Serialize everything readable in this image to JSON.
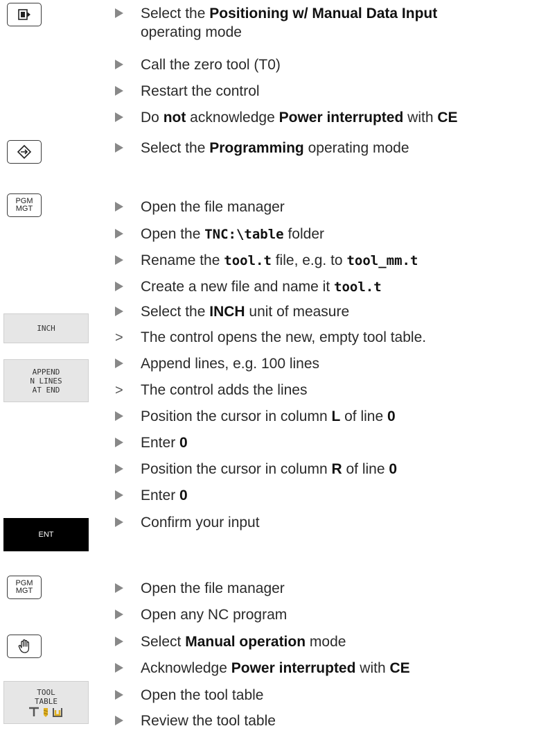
{
  "keys": {
    "mdi_key": "positioning-mdi-key",
    "programming_key": "programming-key",
    "pgm_mgt_1": {
      "line1": "PGM",
      "line2": "MGT"
    },
    "inch": "INCH",
    "append": {
      "line1": "APPEND",
      "line2": "N LINES",
      "line3": "AT END"
    },
    "ent": "ENT",
    "pgm_mgt_2": {
      "line1": "PGM",
      "line2": "MGT"
    },
    "manual_key": "manual-operation-key",
    "tool_table": {
      "line1": "TOOL",
      "line2": "TABLE"
    }
  },
  "steps": {
    "s1": {
      "a": "Select the ",
      "b": "Positioning w/ Manual Data Input",
      "c": "operating mode"
    },
    "s2": {
      "a": "Call the zero tool (T0)"
    },
    "s3": {
      "a": "Restart the control"
    },
    "s4": {
      "a": "Do ",
      "b": "not",
      "c": " acknowledge ",
      "d": "Power interrupted",
      "e": " with ",
      "f": "CE"
    },
    "s5": {
      "a": "Select the ",
      "b": "Programming",
      "c": " operating mode"
    },
    "s6": {
      "a": "Open the file manager"
    },
    "s7": {
      "a": "Open the ",
      "b": "TNC:\\table",
      "c": " folder"
    },
    "s8": {
      "a": "Rename the ",
      "b": "tool.t",
      "c": " file, e.g. to ",
      "d": "tool_mm.t"
    },
    "s9": {
      "a": "Create a new file and name it ",
      "b": "tool.t"
    },
    "s10": {
      "a": "Select the ",
      "b": "INCH",
      "c": " unit of measure"
    },
    "r1": {
      "a": "The control opens the new, empty tool table."
    },
    "s11": {
      "a": "Append lines, e.g. 100 lines"
    },
    "r2": {
      "a": "The control adds the lines"
    },
    "s12": {
      "a": "Position the cursor in column ",
      "b": "L",
      "c": " of line ",
      "d": "0"
    },
    "s13": {
      "a": "Enter ",
      "b": "0"
    },
    "s14": {
      "a": "Position the cursor in column ",
      "b": "R",
      "c": " of line ",
      "d": "0"
    },
    "s15": {
      "a": "Enter ",
      "b": "0"
    },
    "s16": {
      "a": "Confirm your input"
    },
    "s17": {
      "a": "Open the file manager"
    },
    "s18": {
      "a": "Open any NC program"
    },
    "s19": {
      "a": "Select ",
      "b": "Manual operation",
      "c": " mode"
    },
    "s20": {
      "a": "Acknowledge ",
      "b": "Power interrupted",
      "c": " with ",
      "d": "CE"
    },
    "s21": {
      "a": "Open the tool table"
    },
    "s22": {
      "a": "Review the tool table"
    }
  },
  "markers": {
    "step": "bullet-triangle",
    "result": ">"
  }
}
